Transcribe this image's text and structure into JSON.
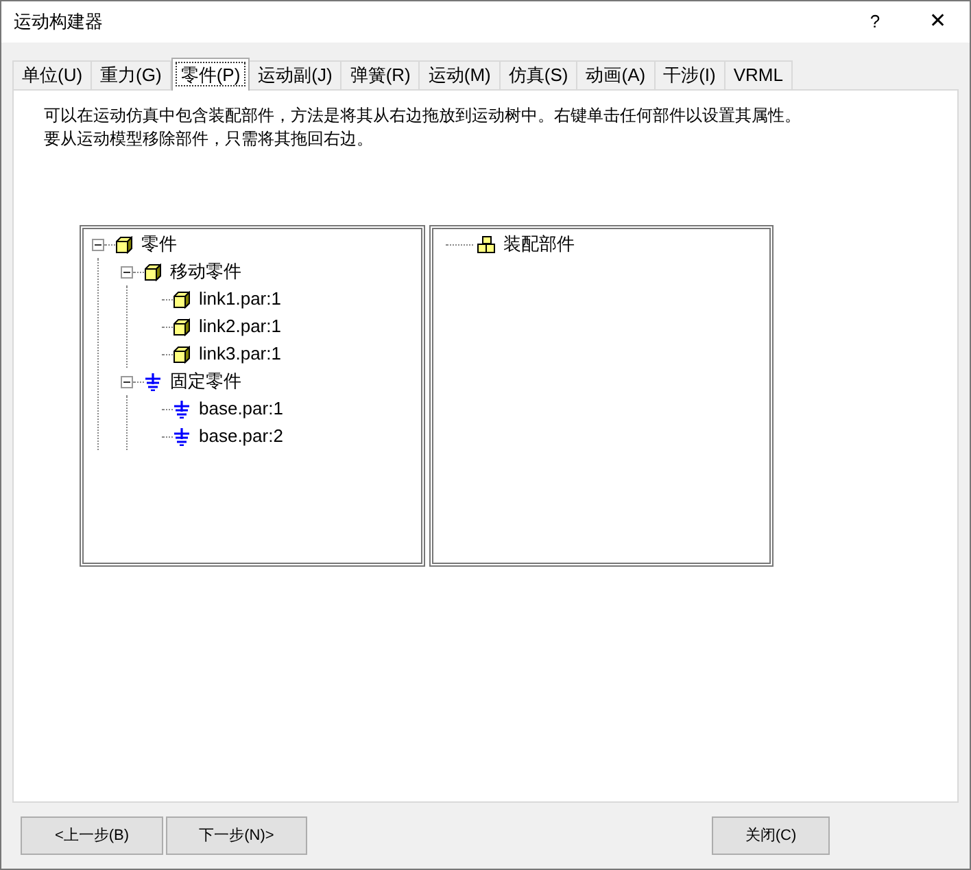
{
  "window": {
    "title": "运动构建器",
    "help": "?",
    "close": "✕"
  },
  "tabs": [
    {
      "label": "单位(U)",
      "selected": false
    },
    {
      "label": "重力(G)",
      "selected": false
    },
    {
      "label": "零件(P)",
      "selected": true
    },
    {
      "label": "运动副(J)",
      "selected": false
    },
    {
      "label": "弹簧(R)",
      "selected": false
    },
    {
      "label": "运动(M)",
      "selected": false
    },
    {
      "label": "仿真(S)",
      "selected": false
    },
    {
      "label": "动画(A)",
      "selected": false
    },
    {
      "label": "干涉(I)",
      "selected": false
    },
    {
      "label": "VRML",
      "selected": false
    }
  ],
  "instructions": [
    "可以在运动仿真中包含装配部件，方法是将其从右边拖放到运动树中。右键单击任何部件以设置其属性。",
    "要从运动模型移除部件，只需将其拖回右边。"
  ],
  "motion_tree": [
    {
      "label": "零件",
      "kind": "cube",
      "expanded": true,
      "children": [
        {
          "label": "移动零件",
          "kind": "cube",
          "expanded": true,
          "children": [
            {
              "label": "link1.par:1",
              "kind": "cube"
            },
            {
              "label": "link2.par:1",
              "kind": "cube"
            },
            {
              "label": "link3.par:1",
              "kind": "cube"
            }
          ]
        },
        {
          "label": "固定零件",
          "kind": "ground",
          "expanded": true,
          "children": [
            {
              "label": "base.par:1",
              "kind": "ground"
            },
            {
              "label": "base.par:2",
              "kind": "ground"
            }
          ]
        }
      ]
    }
  ],
  "assembly_tree": [
    {
      "label": "装配部件",
      "kind": "assembly"
    }
  ],
  "buttons": {
    "back": "<上一步(B)",
    "next": "下一步(N)>",
    "close": "关闭(C)"
  }
}
